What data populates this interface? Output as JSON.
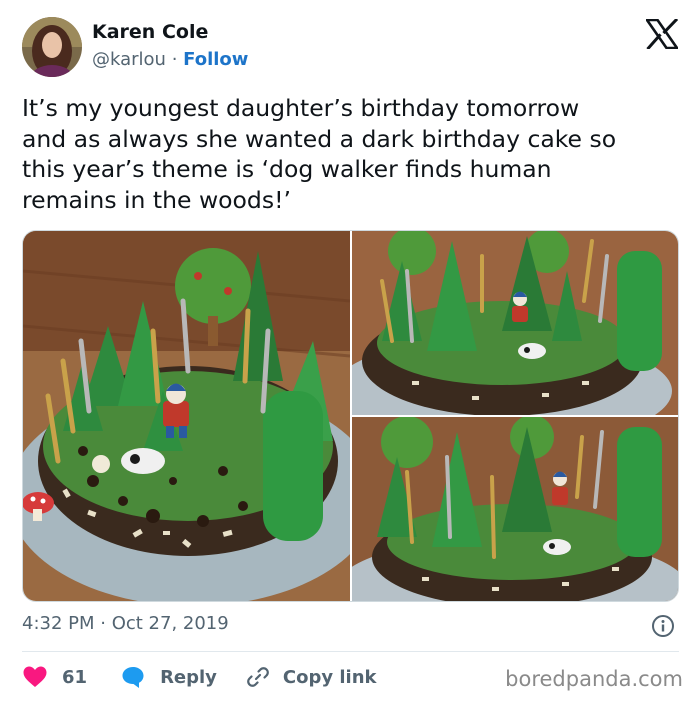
{
  "author": {
    "name": "Karen Cole",
    "handle": "@karlou",
    "separator": " · ",
    "follow_label": "Follow",
    "avatar_icon": "user-avatar"
  },
  "platform_icon": "x-logo-icon",
  "tweet": {
    "text": "It’s my youngest daughter’s birthday tomorrow\nand as always she wanted a dark birthday cake so\nthis year’s theme is ‘dog walker finds human\nremains in the woods!’"
  },
  "media": {
    "count": 3,
    "photos": [
      "cake-photo-main",
      "cake-photo-top-right",
      "cake-photo-bottom-right"
    ]
  },
  "timestamp": "4:32 PM · Oct 27, 2019",
  "actions": {
    "like_count": "61",
    "reply_label": "Reply",
    "copy_label": "Copy link"
  },
  "watermark": "boredpanda.com",
  "colors": {
    "follow": "#1d74c9",
    "like": "#f91880",
    "reply": "#1d9bf0",
    "muted": "#536471"
  }
}
